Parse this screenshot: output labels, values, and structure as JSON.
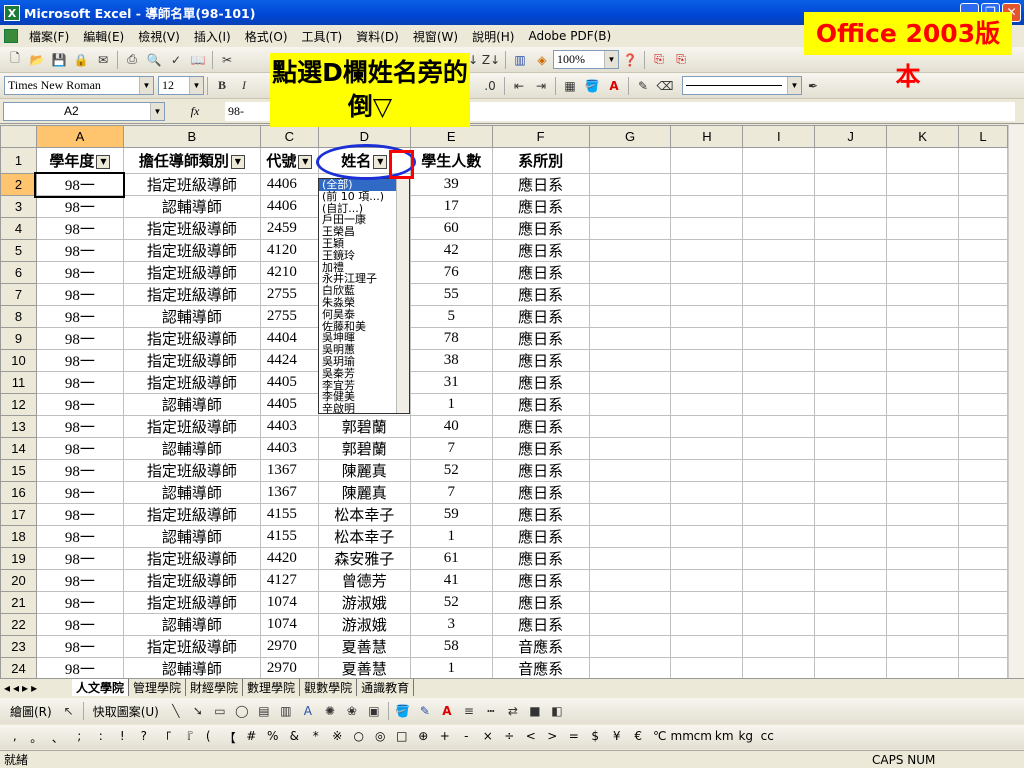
{
  "window": {
    "title": "Microsoft Excel - 導師名單(98-101)"
  },
  "menu": [
    "檔案(F)",
    "編輯(E)",
    "檢視(V)",
    "插入(I)",
    "格式(O)",
    "工具(T)",
    "資料(D)",
    "視窗(W)",
    "說明(H)",
    "Adobe PDF(B)"
  ],
  "toolbar": {
    "zoom": "100%",
    "font_name": "Times New Roman",
    "font_size": "12",
    "bold": "B",
    "italic": "I"
  },
  "formula": {
    "name_box": "A2",
    "fx": "fx",
    "content": "98-"
  },
  "columns": [
    "A",
    "B",
    "C",
    "D",
    "E",
    "F",
    "G",
    "H",
    "I",
    "J",
    "K",
    "L"
  ],
  "header_row": [
    "學年度",
    "擔任導師類別",
    "代號",
    "姓名",
    "學生人數",
    "系所別"
  ],
  "rows": [
    [
      "98一",
      "指定班級導師",
      "4406",
      "",
      "39",
      "應日系"
    ],
    [
      "98一",
      "認輔導師",
      "4406",
      "",
      "17",
      "應日系"
    ],
    [
      "98一",
      "指定班級導師",
      "2459",
      "",
      "60",
      "應日系"
    ],
    [
      "98一",
      "指定班級導師",
      "4120",
      "",
      "42",
      "應日系"
    ],
    [
      "98一",
      "指定班級導師",
      "4210",
      "",
      "76",
      "應日系"
    ],
    [
      "98一",
      "指定班級導師",
      "2755",
      "",
      "55",
      "應日系"
    ],
    [
      "98一",
      "認輔導師",
      "2755",
      "",
      "5",
      "應日系"
    ],
    [
      "98一",
      "指定班級導師",
      "4404",
      "",
      "78",
      "應日系"
    ],
    [
      "98一",
      "指定班級導師",
      "4424",
      "",
      "38",
      "應日系"
    ],
    [
      "98一",
      "指定班級導師",
      "4405",
      "",
      "31",
      "應日系"
    ],
    [
      "98一",
      "認輔導師",
      "4405",
      "",
      "1",
      "應日系"
    ],
    [
      "98一",
      "指定班級導師",
      "4403",
      "郭碧蘭",
      "40",
      "應日系"
    ],
    [
      "98一",
      "認輔導師",
      "4403",
      "郭碧蘭",
      "7",
      "應日系"
    ],
    [
      "98一",
      "指定班級導師",
      "1367",
      "陳麗真",
      "52",
      "應日系"
    ],
    [
      "98一",
      "認輔導師",
      "1367",
      "陳麗真",
      "7",
      "應日系"
    ],
    [
      "98一",
      "指定班級導師",
      "4155",
      "松本幸子",
      "59",
      "應日系"
    ],
    [
      "98一",
      "認輔導師",
      "4155",
      "松本幸子",
      "1",
      "應日系"
    ],
    [
      "98一",
      "指定班級導師",
      "4420",
      "森安雅子",
      "61",
      "應日系"
    ],
    [
      "98一",
      "指定班級導師",
      "4127",
      "曾德芳",
      "41",
      "應日系"
    ],
    [
      "98一",
      "指定班級導師",
      "1074",
      "游淑娥",
      "52",
      "應日系"
    ],
    [
      "98一",
      "認輔導師",
      "1074",
      "游淑娥",
      "3",
      "應日系"
    ],
    [
      "98一",
      "指定班級導師",
      "2970",
      "夏善慧",
      "58",
      "音應系"
    ],
    [
      "98一",
      "認輔導師",
      "2970",
      "夏善慧",
      "1",
      "音應系"
    ]
  ],
  "dropdown_items": [
    "(全部)",
    "(前 10 項...)",
    "(自訂...)",
    "戶田一康",
    "王榮昌",
    "王穎",
    "王鏡玲",
    "加禮",
    "永井江理子",
    "白欣藍",
    "朱淼榮",
    "何昊泰",
    "佐藤和美",
    "吳坤暉",
    "吳明蕙",
    "吳玥瑜",
    "吳秦芳",
    "李宜芳",
    "李健美",
    "辛啟明"
  ],
  "sheet_tabs": [
    "人文學院",
    "管理學院",
    "財經學院",
    "數理學院",
    "觀數學院",
    "通識教育"
  ],
  "draw_toolbar": {
    "draw": "繪圖(R)",
    "autoshapes": "快取圖案(U)"
  },
  "symbols": [
    ",",
    "。",
    "、",
    ";",
    ":",
    "!",
    "?",
    "「",
    "『",
    "(",
    "【",
    "#",
    "%",
    "&",
    "*",
    "※",
    "○",
    "◎",
    "□",
    "⊕",
    "+",
    "-",
    "×",
    "÷",
    "<",
    ">",
    "=",
    "$",
    "¥",
    "€",
    "℃",
    "mm",
    "cm",
    "km",
    "kg",
    "cc"
  ],
  "status": {
    "left": "就緒",
    "right": "CAPS NUM"
  },
  "annotations": {
    "callout": "點選D欄姓名旁的倒▽",
    "badge": "Office 2003版本"
  }
}
